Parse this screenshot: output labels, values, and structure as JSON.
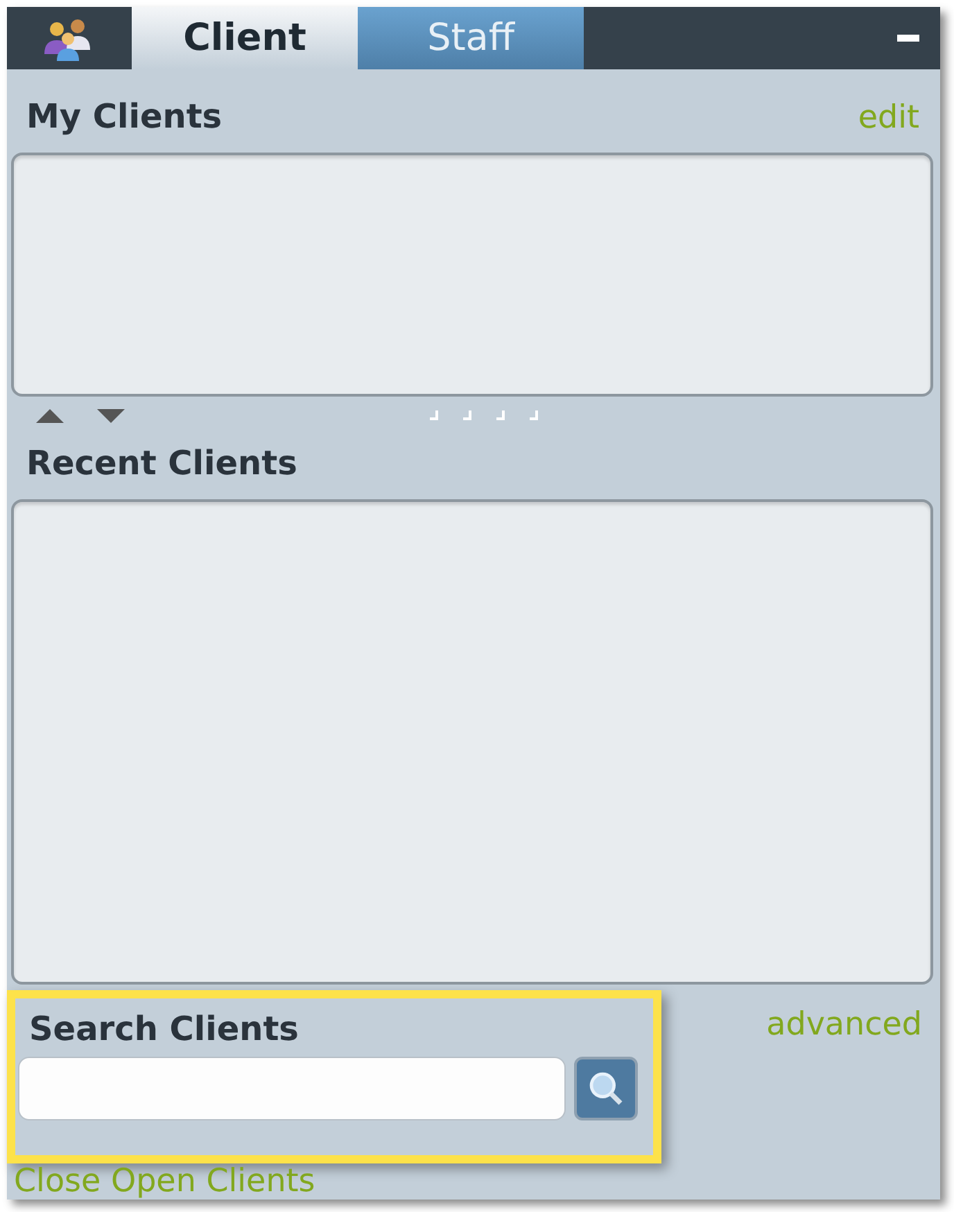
{
  "tabs": [
    {
      "label": "Client",
      "selected": true
    },
    {
      "label": "Staff",
      "selected": false
    }
  ],
  "my_clients": {
    "title": "My Clients",
    "link": "edit"
  },
  "recent_clients": {
    "title": "Recent Clients"
  },
  "search": {
    "title": "Search Clients",
    "link": "advanced",
    "highlighted": true
  },
  "footer_link": "Close Open Clients"
}
